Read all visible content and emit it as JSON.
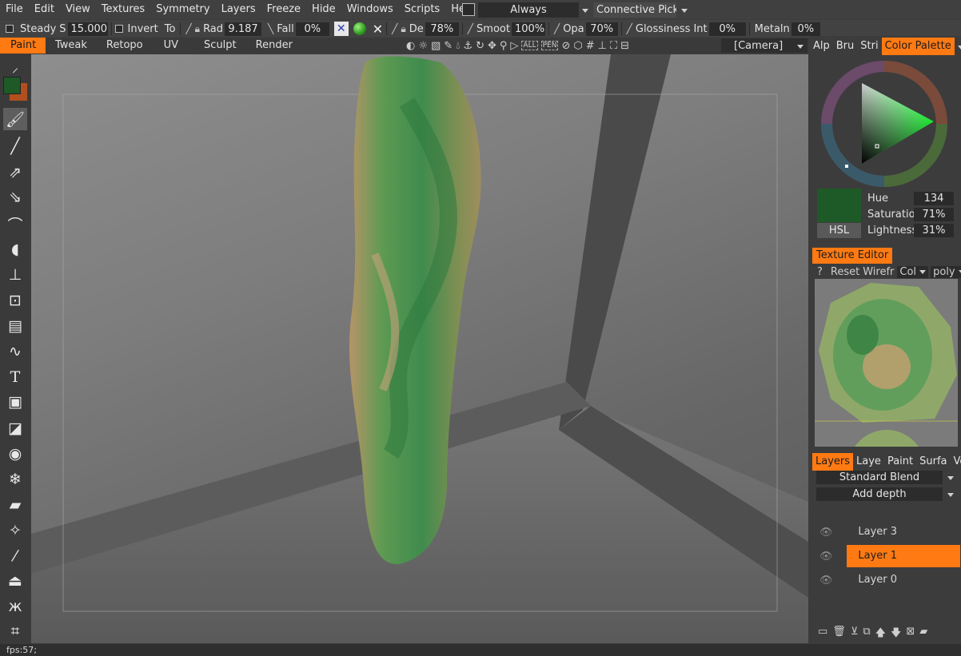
{
  "menu": {
    "items": [
      "File",
      "Edit",
      "View",
      "Textures",
      "Symmetry",
      "Layers",
      "Freeze",
      "Hide",
      "Windows",
      "Scripts",
      "Help"
    ],
    "mode_value": "Always",
    "picking_value": "Connective Picki"
  },
  "toolbar": {
    "steady_label": "Steady",
    "s_label": "S",
    "steady_value": "15.000",
    "invert_label": "Invert",
    "to_label": "To",
    "radius_label": "Rad",
    "radius_value": "9.187",
    "falloff_label": "Fall",
    "falloff_value": "0%",
    "depth_label": "De",
    "depth_value": "78%",
    "smooth_label": "Smoot",
    "smooth_value": "100%",
    "opacity_label": "Opa",
    "opacity_value": "70%",
    "glossiness_label": "Glossiness",
    "int_label": "Int",
    "glossiness_value": "0%",
    "metal_label": "Metaln",
    "metal_value": "0%"
  },
  "rooms": {
    "tabs": [
      "Paint",
      "Tweak",
      "Retopo",
      "UV",
      "Sculpt",
      "Render"
    ],
    "active": "Paint",
    "camera": "[Camera]"
  },
  "color_panel": {
    "tabs": [
      "Alp",
      "Bru",
      "Stri",
      "Color Palette"
    ],
    "active_tab": "Color Palette",
    "swatch_color": "#1d5a27",
    "mode": "HSL",
    "hue_label": "Hue",
    "hue_value": "134",
    "saturation_label": "Saturatio",
    "saturation_value": "71%",
    "lightness_label": "Lightness",
    "lightness_value": "31%"
  },
  "texture_editor": {
    "title": "Texture Editor",
    "help": "?",
    "reset": "Reset",
    "wireframe": "Wirefr",
    "color_select": "Col",
    "poly_select": "poly"
  },
  "layers_panel": {
    "tabs": [
      "Layers",
      "Laye",
      "Paint",
      "Surfa",
      "VoxT"
    ],
    "active_tab": "Layers",
    "blend_mode": "Standard  Blend",
    "depth_mode": "Add  depth",
    "layers": [
      {
        "name": "Layer  3",
        "active": false
      },
      {
        "name": "Layer  1",
        "active": true
      },
      {
        "name": "Layer  0",
        "active": false
      }
    ]
  },
  "status": {
    "fps": "fps:57;"
  },
  "colors": {
    "accent": "#ff7a12",
    "primary_color": "#1d5a27",
    "secondary_color": "#b0501f"
  }
}
